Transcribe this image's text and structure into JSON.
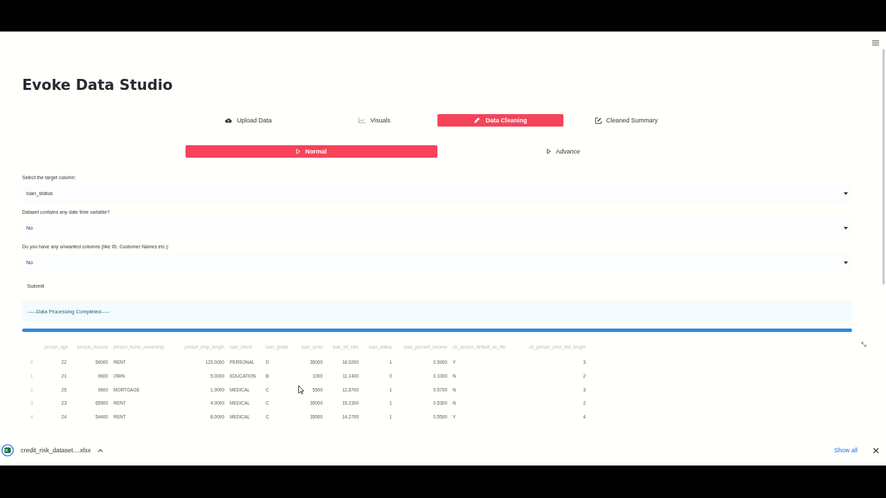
{
  "title": "Evoke Data Studio",
  "tabs": [
    {
      "label": "Upload Data",
      "kind": "upload",
      "selected": false
    },
    {
      "label": "Visuals",
      "kind": "chart",
      "selected": false
    },
    {
      "label": "Data Cleaning",
      "kind": "pencil",
      "selected": true
    },
    {
      "label": "Cleaned Summary",
      "kind": "edit",
      "selected": false
    }
  ],
  "subtabs": [
    {
      "label": "Normal",
      "selected": true
    },
    {
      "label": "Advance",
      "selected": false
    }
  ],
  "fields": [
    {
      "label": "Select the target column:",
      "value": "loan_status"
    },
    {
      "label": "Dataset contains any date time variable?",
      "value": "No"
    },
    {
      "label": "Do you have any unwanted columns (like ID, Customer Names etc.):",
      "value": "No"
    }
  ],
  "submit": "Submit",
  "status_message": "-----Data Processing Completed-----",
  "progress": {
    "level": 1.0
  },
  "table": {
    "columns": [
      {
        "label": "person_age",
        "kind": "number"
      },
      {
        "label": "person_income",
        "kind": "number"
      },
      {
        "label": "person_home_ownership",
        "kind": "text"
      },
      {
        "label": "person_emp_length",
        "kind": "number"
      },
      {
        "label": "loan_intent",
        "kind": "text"
      },
      {
        "label": "loan_grade",
        "kind": "text"
      },
      {
        "label": "loan_amnt",
        "kind": "number"
      },
      {
        "label": "loan_int_rate",
        "kind": "number"
      },
      {
        "label": "loan_status",
        "kind": "number"
      },
      {
        "label": "loan_percent_income",
        "kind": "number"
      },
      {
        "label": "cb_person_default_on_file",
        "kind": "text"
      },
      {
        "label": "cb_person_cred_hist_length",
        "kind": "number"
      }
    ],
    "rows": [
      {
        "index": "0",
        "cells": [
          "22",
          "59000",
          "RENT",
          "123.0000",
          "PERSONAL",
          "D",
          "35000",
          "16.0200",
          "1",
          "0.5900",
          "Y",
          "3"
        ]
      },
      {
        "index": "1",
        "cells": [
          "21",
          "9600",
          "OWN",
          "5.0000",
          "EDUCATION",
          "B",
          "1000",
          "11.1400",
          "0",
          "0.1000",
          "N",
          "2"
        ]
      },
      {
        "index": "2",
        "cells": [
          "25",
          "9600",
          "MORTGAGE",
          "1.0000",
          "MEDICAL",
          "C",
          "5500",
          "12.8700",
          "1",
          "0.5700",
          "N",
          "3"
        ]
      },
      {
        "index": "3",
        "cells": [
          "23",
          "65500",
          "RENT",
          "4.0000",
          "MEDICAL",
          "C",
          "35000",
          "15.2300",
          "1",
          "0.5300",
          "N",
          "2"
        ]
      },
      {
        "index": "4",
        "cells": [
          "24",
          "54400",
          "RENT",
          "8.0000",
          "MEDICAL",
          "C",
          "35000",
          "14.2700",
          "1",
          "0.5500",
          "Y",
          "4"
        ]
      }
    ]
  },
  "download_bar": {
    "file": "credit_risk_dataset....xlsx",
    "show_all": "Show all"
  }
}
